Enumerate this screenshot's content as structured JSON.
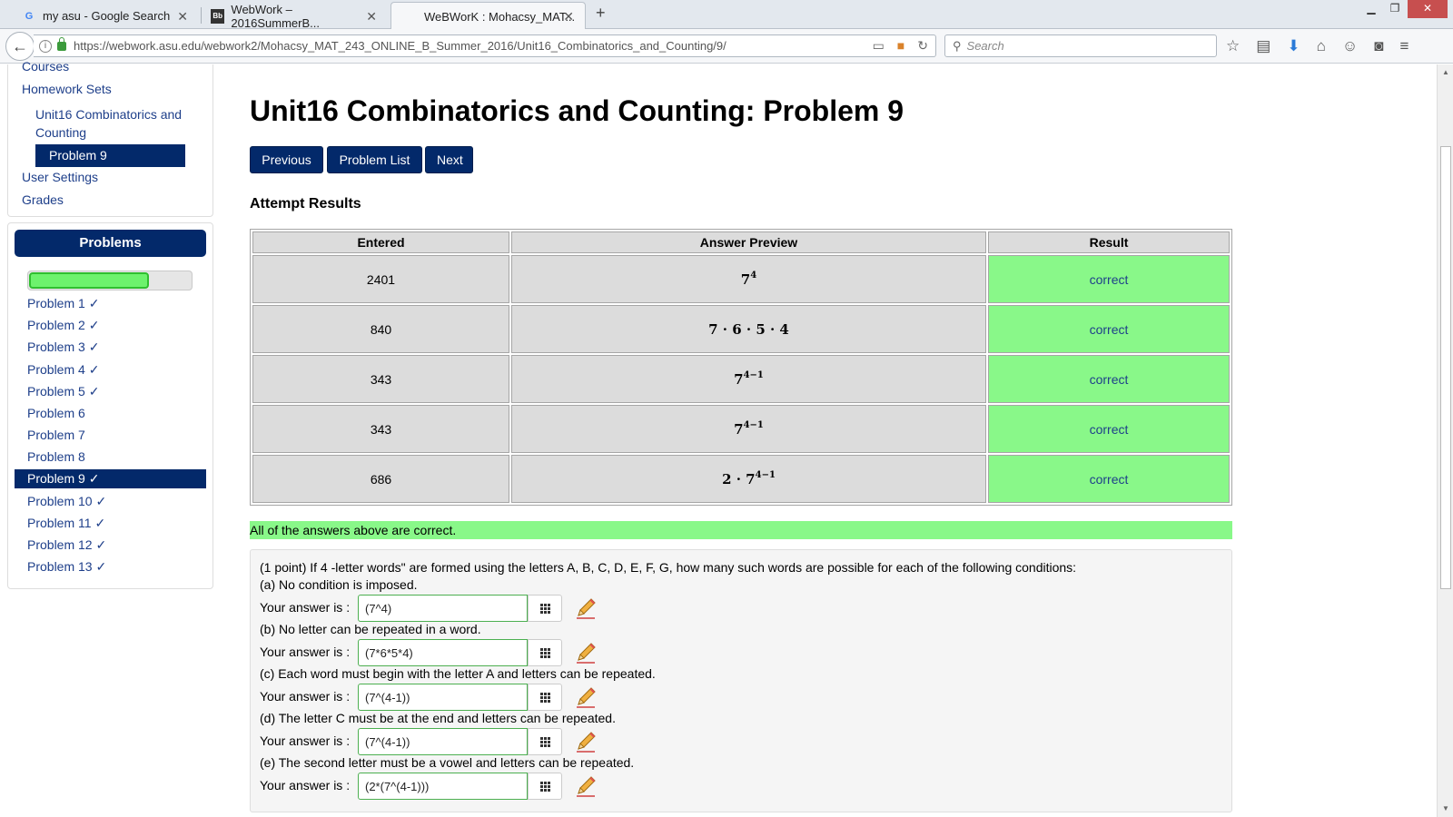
{
  "browser": {
    "tabs": [
      {
        "title": "my asu - Google Search",
        "icon": "google-icon"
      },
      {
        "title": "WebWork – 2016SummerB...",
        "icon": "blackboard-icon"
      },
      {
        "title": "WeBWorK : Mohacsy_MAT...",
        "icon": "none"
      }
    ],
    "url": "https://webwork.asu.edu/webwork2/Mohacsy_MAT_243_ONLINE_B_Summer_2016/Unit16_Combinatorics_and_Counting/9/",
    "search_placeholder": "Search"
  },
  "sidebar": {
    "courses": "Courses",
    "homework_sets": "Homework Sets",
    "unit": "Unit16 Combinatorics and Counting",
    "current_problem": "Problem 9",
    "user_settings": "User Settings",
    "grades": "Grades",
    "problems_header": "Problems",
    "progress_fraction": 0.74,
    "problems": [
      {
        "label": "Problem 1 ✓",
        "current": false
      },
      {
        "label": "Problem 2 ✓",
        "current": false
      },
      {
        "label": "Problem 3 ✓",
        "current": false
      },
      {
        "label": "Problem 4 ✓",
        "current": false
      },
      {
        "label": "Problem 5 ✓",
        "current": false
      },
      {
        "label": "Problem 6",
        "current": false
      },
      {
        "label": "Problem 7",
        "current": false
      },
      {
        "label": "Problem 8",
        "current": false
      },
      {
        "label": "Problem 9 ✓",
        "current": true
      },
      {
        "label": "Problem 10 ✓",
        "current": false
      },
      {
        "label": "Problem 11 ✓",
        "current": false
      },
      {
        "label": "Problem 12 ✓",
        "current": false
      },
      {
        "label": "Problem 13 ✓",
        "current": false
      }
    ]
  },
  "main": {
    "title": "Unit16 Combinatorics and Counting: Problem 9",
    "buttons": {
      "previous": "Previous",
      "problem_list": "Problem List",
      "next": "Next"
    },
    "attempt_title": "Attempt Results",
    "table": {
      "headers": [
        "Entered",
        "Answer Preview",
        "Result"
      ],
      "rows": [
        {
          "entered": "2401",
          "preview_base": "7",
          "preview_exp": "4",
          "result": "correct"
        },
        {
          "entered": "840",
          "preview_base": "7 · 6 · 5 · 4",
          "preview_exp": "",
          "result": "correct"
        },
        {
          "entered": "343",
          "preview_base": "7",
          "preview_exp": "4−1",
          "result": "correct"
        },
        {
          "entered": "343",
          "preview_base": "7",
          "preview_exp": "4−1",
          "result": "correct"
        },
        {
          "entered": "686",
          "preview_base": "2 · 7",
          "preview_exp": "4−1",
          "result": "correct"
        }
      ]
    },
    "summary": "All of the answers above are correct.",
    "problem": {
      "statement": "(1 point) If 4 -letter words\" are formed using the letters A, B, C, D, E, F, G, how many such words are possible for each of the following conditions:",
      "answer_label": "Your answer is :",
      "parts": [
        {
          "text": "(a) No condition is imposed.",
          "answer": "(7^4)"
        },
        {
          "text": "(b) No letter can be repeated in a word.",
          "answer": "(7*6*5*4)"
        },
        {
          "text": "(c) Each word must begin with the letter A and letters can be repeated.",
          "answer": "(7^(4-1))"
        },
        {
          "text": "(d) The letter C must be at the end and letters can be repeated.",
          "answer": "(7^(4-1))"
        },
        {
          "text": "(e) The second letter must be a vowel and letters can be repeated.",
          "answer": "(2*(7^(4-1)))"
        }
      ]
    }
  },
  "colors": {
    "nav_blue": "#03296a",
    "link_blue": "#1e3f8a",
    "correct_green": "#89f889"
  }
}
